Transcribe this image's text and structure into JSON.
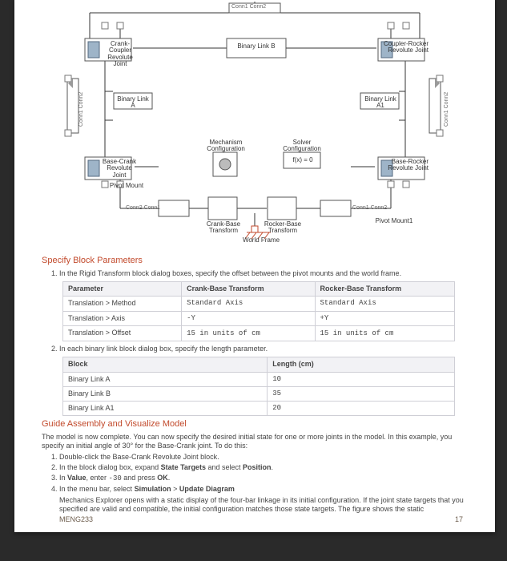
{
  "diagram": {
    "top_ports": "Conn1 Conn2",
    "crank_coupler": {
      "l1": "Crank-Coupler",
      "l2": "Revolute Joint"
    },
    "binary_link_b": "Binary Link B",
    "coupler_rocker": {
      "l1": "Coupler-Rocker",
      "l2": "Revolute Joint"
    },
    "left_side_ports": "Conn1 Conn2",
    "right_side_ports": "Conn1 Conn2",
    "binary_link_a": "Binary Link A",
    "binary_link_a1": "Binary Link A1",
    "base_crank": {
      "l1": "Base-Crank",
      "l2": "Revolute Joint"
    },
    "mech_config": {
      "l1": "Mechanism",
      "l2": "Configuration"
    },
    "solver": {
      "l1": "Solver",
      "l2": "Configuration"
    },
    "fx": "f(x) = 0",
    "base_rocker": {
      "l1": "Base-Rocker",
      "l2": "Revolute Joint"
    },
    "pivot_mount_left": "Pivot Mount",
    "pivot_mount_right": "Pivot Mount1",
    "conn2_conn1_left": "Conn2 Conn1",
    "conn1_conn2_right": "Conn1 Conn2",
    "crank_base_tr": {
      "l1": "Crank-Base",
      "l2": "Transform"
    },
    "rocker_base_tr": {
      "l1": "Rocker-Base",
      "l2": "Transform"
    },
    "world_frame": "World Frame"
  },
  "specify_header": "Specify Block Parameters",
  "step1": "In the Rigid Transform block dialog boxes, specify the offset between the pivot mounts and the world frame.",
  "table1": {
    "headers": [
      "Parameter",
      "Crank-Base Transform",
      "Rocker-Base Transform"
    ],
    "rows": [
      [
        "Translation > Method",
        "Standard Axis",
        "Standard Axis"
      ],
      [
        "Translation > Axis",
        "-Y",
        "+Y"
      ],
      [
        "Translation > Offset",
        "15 in units of cm",
        "15 in units of cm"
      ]
    ]
  },
  "step2": "In each binary link block dialog box, specify the length parameter.",
  "table2": {
    "headers": [
      "Block",
      "Length (cm)"
    ],
    "rows": [
      [
        "Binary Link A",
        "10"
      ],
      [
        "Binary Link B",
        "35"
      ],
      [
        "Binary Link A1",
        "20"
      ]
    ]
  },
  "guide_header": "Guide Assembly and Visualize Model",
  "guide_intro": "The model is now complete. You can now specify the desired initial state for one or more joints in the model. In this example, you specify an initial angle of 30° for the Base-Crank joint. To do this:",
  "g1": "Double-click the Base-Crank Revolute Joint block.",
  "g2a": "In the block dialog box, expand ",
  "g2b": "State Targets",
  "g2c": " and select ",
  "g2d": "Position",
  "g2e": ".",
  "g3a": "In ",
  "g3b": "Value",
  "g3c": ", enter ",
  "g3d": "-30",
  "g3e": " and press ",
  "g3f": "OK",
  "g3g": ".",
  "g4a": "In the menu bar, select ",
  "g4b": "Simulation",
  "g4c": " > ",
  "g4d": "Update Diagram",
  "g_tail": "Mechanics Explorer opens with a static display of the four-bar linkage in its initial configuration. If the joint state targets that you specified are valid and compatible, the initial configuration matches those state targets. The figure shows the static",
  "footer": {
    "left": "MENG233",
    "right": "17"
  }
}
